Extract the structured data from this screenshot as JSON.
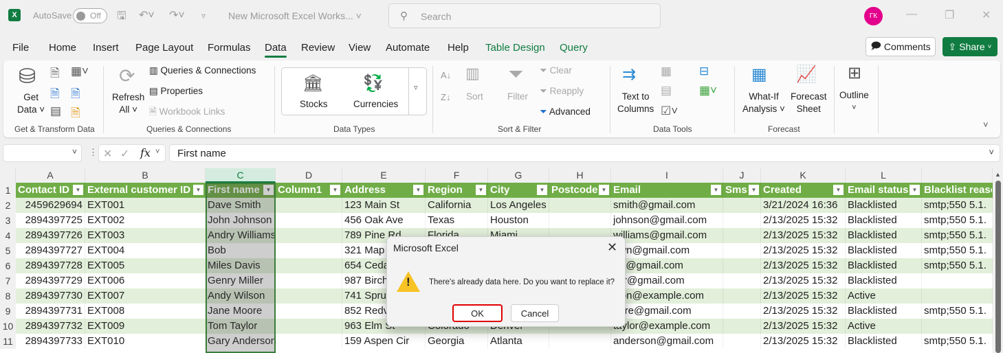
{
  "titlebar": {
    "app_icon": "excel-logo-icon",
    "app_letter": "X",
    "autosave_label": "AutoSave",
    "autosave_state": "Off",
    "doc_title": "New Microsoft Excel Works...",
    "search_placeholder": "Search",
    "avatar_initials": "ГК",
    "minimize": "—",
    "restore": "❐",
    "close": "✕"
  },
  "menu": {
    "items": [
      "File",
      "Home",
      "Insert",
      "Page Layout",
      "Formulas",
      "Data",
      "Review",
      "View",
      "Automate",
      "Help",
      "Table Design",
      "Query"
    ],
    "active": "Data",
    "comments_label": "Comments",
    "share_label": "Share"
  },
  "ribbon": {
    "groups": {
      "get_transform": {
        "label": "Get & Transform Data",
        "get_data_line1": "Get",
        "get_data_line2": "Data ˅"
      },
      "queries": {
        "label": "Queries & Connections",
        "refresh_line1": "Refresh",
        "refresh_line2": "All ˅",
        "queries_connections": "Queries & Connections",
        "properties": "Properties",
        "workbook_links": "Workbook Links"
      },
      "data_types": {
        "label": "Data Types",
        "stocks": "Stocks",
        "currencies": "Currencies"
      },
      "sort_filter": {
        "label": "Sort & Filter",
        "sort": "Sort",
        "filter": "Filter",
        "clear": "Clear",
        "reapply": "Reapply",
        "advanced": "Advanced"
      },
      "data_tools": {
        "label": "Data Tools",
        "text_to_columns_line1": "Text to",
        "text_to_columns_line2": "Columns"
      },
      "forecast": {
        "label": "Forecast",
        "whatif_line1": "What-If",
        "whatif_line2": "Analysis ˅",
        "forecast_line1": "Forecast",
        "forecast_line2": "Sheet"
      },
      "outline": {
        "label": "Outline"
      }
    }
  },
  "formula_bar": {
    "name_box": "",
    "fx": "fx",
    "content": "First name"
  },
  "sheet": {
    "columns": [
      "A",
      "B",
      "C",
      "D",
      "E",
      "F",
      "G",
      "H",
      "I",
      "J",
      "K",
      "L"
    ],
    "selected_column": "C",
    "headers": [
      "Contact ID",
      "External customer ID",
      "First name",
      "Column1",
      "Address",
      "Region",
      "City",
      "Postcode",
      "Email",
      "Sms",
      "Created",
      "Email status",
      "Blacklist reaso"
    ],
    "rows": [
      {
        "n": "2",
        "cells": [
          "2459629694",
          "EXT001",
          "Dave Smith",
          "",
          "123 Main St",
          "California",
          "Los Angeles",
          "",
          "smith@gmail.com",
          "",
          "3/21/2024 16:36",
          "Blacklisted",
          "smtp;550 5.1."
        ]
      },
      {
        "n": "3",
        "cells": [
          "2894397725",
          "EXT002",
          "John Johnson",
          "",
          "456 Oak Ave",
          "Texas",
          "Houston",
          "",
          "johnson@gmail.com",
          "",
          "2/13/2025 15:32",
          "Blacklisted",
          "smtp;550 5.1."
        ]
      },
      {
        "n": "4",
        "cells": [
          "2894397726",
          "EXT003",
          "Andry Williams",
          "",
          "789 Pine Rd",
          "Florida",
          "Miami",
          "",
          "williams@gmail.com",
          "",
          "2/13/2025 15:32",
          "Blacklisted",
          "smtp;550 5.1."
        ]
      },
      {
        "n": "5",
        "cells": [
          "2894397727",
          "EXT004",
          "Bob",
          "",
          "321 Map",
          "",
          "",
          "",
          "own@gmail.com",
          "",
          "2/13/2025 15:32",
          "Blacklisted",
          "smtp;550 5.1."
        ]
      },
      {
        "n": "6",
        "cells": [
          "2894397728",
          "EXT005",
          "Miles Davis",
          "",
          "654 Ceda",
          "",
          "",
          "",
          "vis@gmail.com",
          "",
          "2/13/2025 15:32",
          "Blacklisted",
          "smtp;550 5.1."
        ]
      },
      {
        "n": "7",
        "cells": [
          "2894397729",
          "EXT006",
          "Genry Miller",
          "",
          "987 Birch",
          "",
          "",
          "",
          "ller@gmail.com",
          "",
          "2/13/2025 15:32",
          "Blacklisted",
          ""
        ]
      },
      {
        "n": "8",
        "cells": [
          "2894397730",
          "EXT007",
          "Andy Wilson",
          "",
          "741 Spru",
          "",
          "",
          "",
          "lson@example.com",
          "",
          "2/13/2025 15:32",
          "Active",
          ""
        ]
      },
      {
        "n": "9",
        "cells": [
          "2894397731",
          "EXT008",
          "Jane Moore",
          "",
          "852 Redv",
          "",
          "",
          "",
          "oore@gmail.com",
          "",
          "2/13/2025 15:32",
          "Blacklisted",
          "smtp;550 5.1."
        ]
      },
      {
        "n": "10",
        "cells": [
          "2894397732",
          "EXT009",
          "Tom Taylor",
          "",
          "963 Elm St",
          "Colorado",
          "Denver",
          "",
          "taylor@example.com",
          "",
          "2/13/2025 15:32",
          "Active",
          ""
        ]
      },
      {
        "n": "11",
        "cells": [
          "2894397733",
          "EXT010",
          "Gary Anderson",
          "",
          "159 Aspen Cir",
          "Georgia",
          "Atlanta",
          "",
          "anderson@gmail.com",
          "",
          "2/13/2025 15:32",
          "Blacklisted",
          "smtp;550 5.1."
        ]
      }
    ]
  },
  "dialog": {
    "title": "Microsoft Excel",
    "message": "There's already data here. Do you want to replace it?",
    "ok_label": "OK",
    "cancel_label": "Cancel",
    "close": "✕",
    "icon": "warning-icon"
  },
  "colors": {
    "accent": "#107c41",
    "table_header": "#70ad47",
    "table_band": "#e2efda",
    "highlight_border": "#e00000",
    "avatar": "#e3008c"
  }
}
